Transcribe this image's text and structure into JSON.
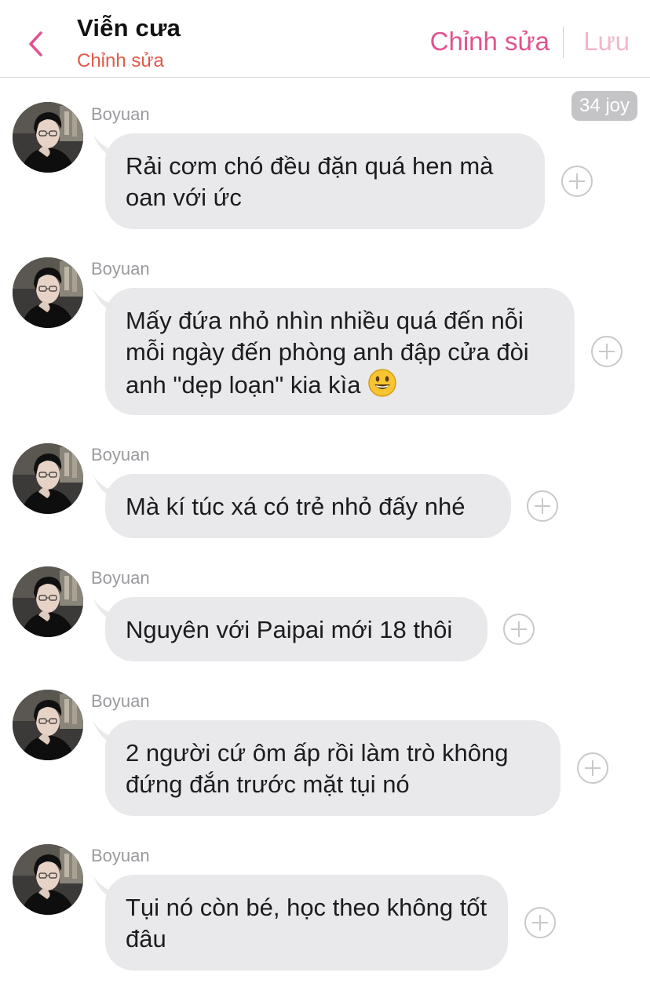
{
  "header": {
    "title": "Viễn cưa",
    "subtitle": "Chỉnh sửa",
    "edit_label": "Chỉnh sửa",
    "save_label": "Lưu"
  },
  "reaction_count": "34 joy",
  "messages": [
    {
      "sender": "Boyuan",
      "text": "Rải cơm chó đều đặn quá hen mà oan với ức"
    },
    {
      "sender": "Boyuan",
      "text": "Mấy đứa nhỏ nhìn nhiều quá đến nỗi mỗi ngày đến phòng anh đập cửa đòi anh \"dẹp loạn\" kia kìa",
      "emoji": "smiling-face-icon"
    },
    {
      "sender": "Boyuan",
      "text": "Mà kí túc xá có trẻ nhỏ đấy nhé"
    },
    {
      "sender": "Boyuan",
      "text": "Nguyên với Paipai mới 18 thôi"
    },
    {
      "sender": "Boyuan",
      "text": "2 người cứ ôm ấp rồi làm trò không đứng đắn trước mặt tụi nó"
    },
    {
      "sender": "Boyuan",
      "text": "Tụi nó còn bé, học theo không tốt đâu"
    }
  ],
  "colors": {
    "accent": "#e2528f",
    "accent_disabled": "#f2b6cc",
    "subtitle": "#e05a47",
    "bubble": "#e9e9eb"
  }
}
